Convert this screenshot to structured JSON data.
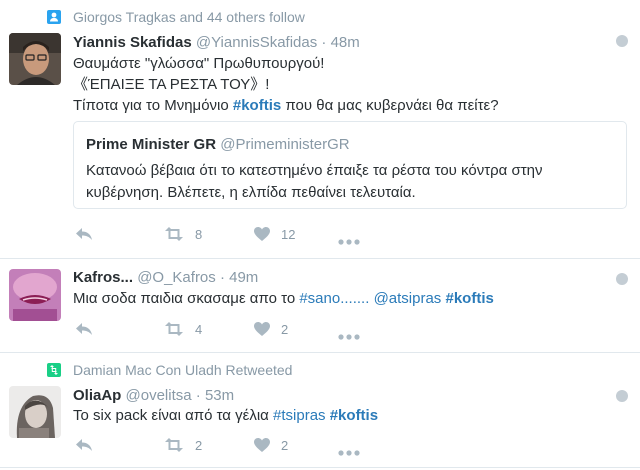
{
  "tweets": [
    {
      "context": "Giorgos Tragkas and 44 others follow",
      "context_icon": "follow-icon",
      "name": "Yiannis Skafidas",
      "handle": "@YiannisSkafidas",
      "dot": "·",
      "time": "48m",
      "lines": [
        "Θαυμάστε \"γλώσσα\" Πρωθυπουργού!",
        "《ΈΠΑΙΞΕ ΤΑ ΡΕΣΤΑ ΤΟΥ》!"
      ],
      "line3_pre": "Τίποτα για το Μνημόνιο ",
      "line3_tag": "#koftis",
      "line3_post": " που θα μας κυβερνάει θα πείτε?",
      "quote": {
        "name": "Prime Minister GR",
        "handle": "@PrimeministerGR",
        "text": "Κατανοώ βέβαια ότι το κατεστημένο έπαιξε τα ρέστα του κόντρα στην κυβέρνηση. Βλέπετε, η ελπίδα πεθαίνει τελευταία."
      },
      "retweets": "8",
      "likes": "12"
    },
    {
      "name": "Kafros...",
      "handle": "@O_Kafros",
      "dot": "·",
      "time": "49m",
      "pre": "Μια σοδα παιδια σκασαμε απο το ",
      "tag1": "#sano.......",
      "mid": " ",
      "tag2": "@atsipras",
      "tag3": "#koftis",
      "retweets": "4",
      "likes": "2"
    },
    {
      "context": "Damian Mac Con Uladh Retweeted",
      "context_icon": "retweet-icon",
      "name": "OliaAp",
      "handle": "@ovelitsa",
      "dot": "·",
      "time": "53m",
      "pre": "Το six pack είναι από τα γέλια ",
      "tag1": "#tsipras",
      "tag2": "#koftis",
      "retweets": "2",
      "likes": "2"
    }
  ],
  "colors": {
    "link": "#2b7bb9",
    "muted": "#8899a6",
    "text": "#292f33",
    "follow_icon": "#2aa3ef",
    "retweet_icon": "#19cf86",
    "divider": "#e1e8ed",
    "action_icon": "#aab8c2"
  }
}
